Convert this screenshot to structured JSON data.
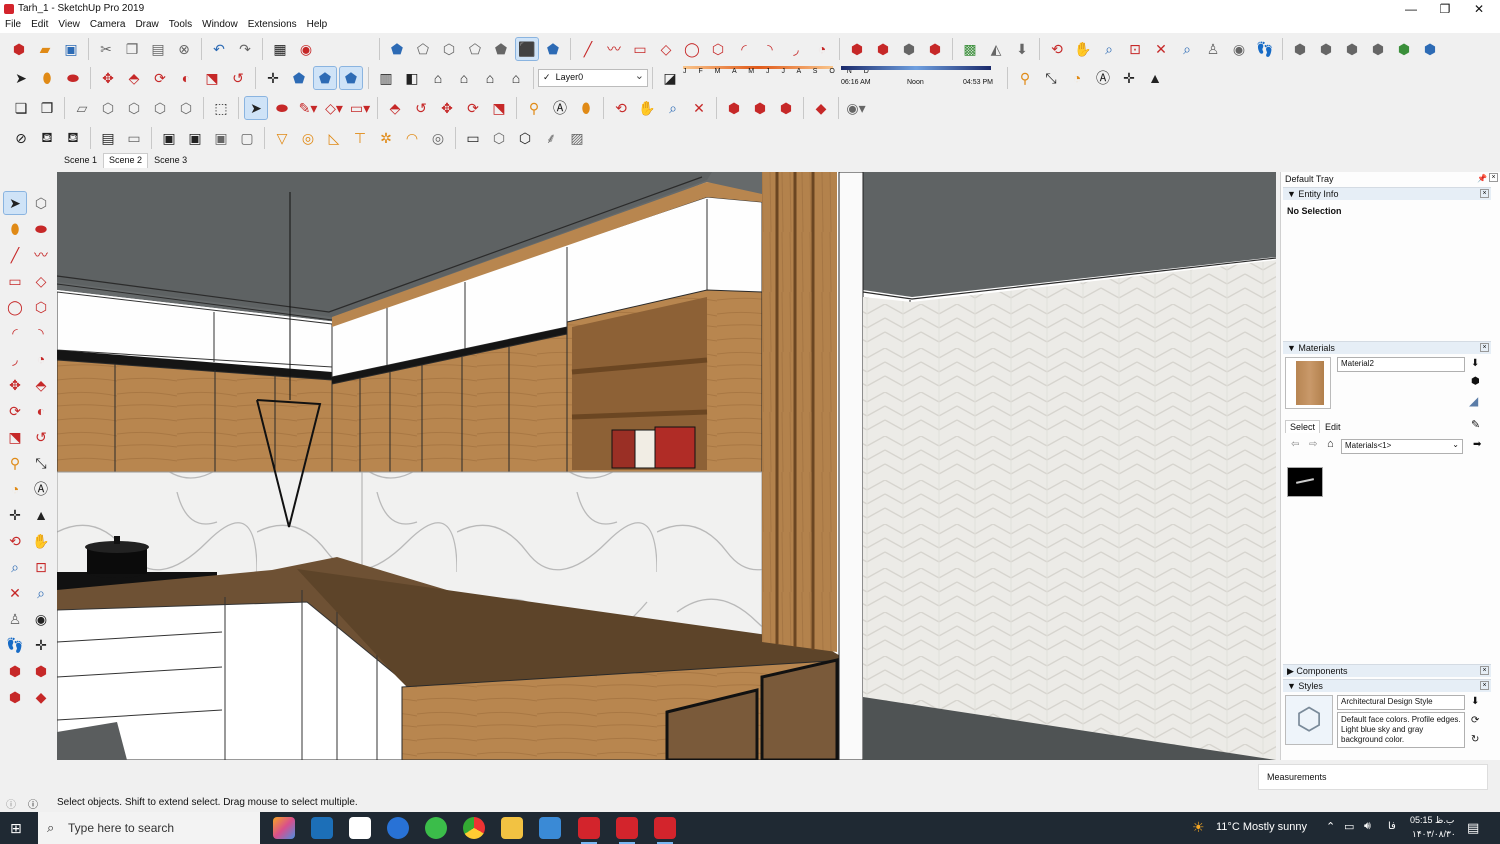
{
  "window": {
    "title": "Tarh_1 - SketchUp Pro 2019",
    "minimize": "—",
    "maximize": "❐",
    "close": "✕"
  },
  "menu": [
    "File",
    "Edit",
    "View",
    "Camera",
    "Draw",
    "Tools",
    "Window",
    "Extensions",
    "Help"
  ],
  "layers": {
    "current": "Layer0",
    "check": "✓"
  },
  "shadows": {
    "months": "J F M A M J J A S O N D",
    "time_start": "06:16 AM",
    "time_mid": "Noon",
    "time_end": "04:53 PM"
  },
  "scenes": {
    "tabs": [
      "Scene 1",
      "Scene 2",
      "Scene 3"
    ],
    "selected_index": 1
  },
  "tray": {
    "title": "Default Tray",
    "entity_info": {
      "header": "Entity Info",
      "value": "No Selection"
    },
    "materials": {
      "header": "Materials",
      "current_name": "Material2",
      "tab_select": "Select",
      "tab_edit": "Edit",
      "library": "Materials<1>"
    },
    "components": {
      "header": "Components"
    },
    "styles": {
      "header": "Styles",
      "style_name": "Architectural Design Style",
      "description": "Default face colors. Profile edges. Light blue sky and gray background color."
    }
  },
  "measurements": {
    "label": "Measurements"
  },
  "status": {
    "text": "Select objects. Shift to extend select. Drag mouse to select multiple."
  },
  "taskbar": {
    "search_placeholder": "Type here to search",
    "weather": "11°C  Mostly sunny",
    "time": "05:15 ب.ظ",
    "date": "۱۴۰۳/۰۸/۳۰",
    "lang": "فا"
  },
  "colors": {
    "accent": "#2d6bb5",
    "sketchup_red": "#d3242c",
    "wood": "#a77a48",
    "taskbar": "#1f2933"
  }
}
